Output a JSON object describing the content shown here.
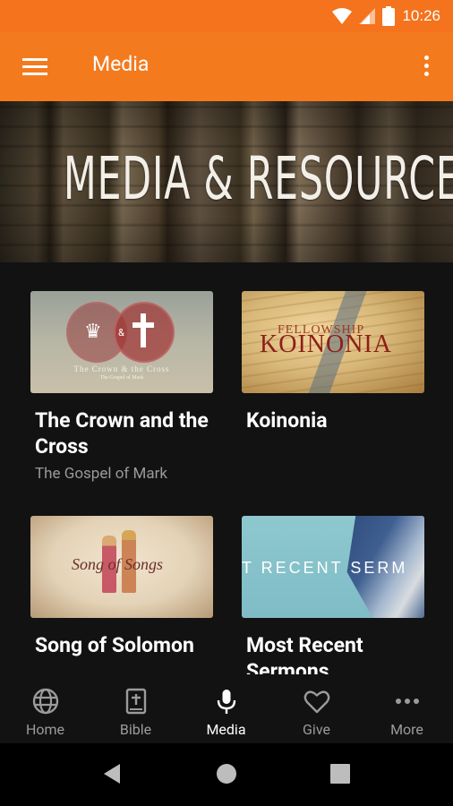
{
  "status_bar": {
    "time": "10:26"
  },
  "app_bar": {
    "title": "Media"
  },
  "hero": {
    "title": "MEDIA & RESOURCES"
  },
  "cards": [
    {
      "title": "The Crown and the Cross",
      "subtitle": "The Gospel of Mark",
      "thumb_caption": "The Crown & the Cross",
      "thumb_subcaption": "The Gospel of Mark"
    },
    {
      "title": "Koinonia",
      "subtitle": "",
      "thumb_fellow": "FELLOWSHIP",
      "thumb_main": "KOINONIA"
    },
    {
      "title": "Song of Solomon",
      "subtitle": "",
      "thumb_main": "Song of Songs"
    },
    {
      "title": "Most Recent Sermons",
      "subtitle": "",
      "thumb_main": "T RECENT SERM"
    }
  ],
  "bottom_nav": [
    {
      "label": "Home",
      "icon": "globe-icon"
    },
    {
      "label": "Bible",
      "icon": "bible-icon"
    },
    {
      "label": "Media",
      "icon": "microphone-icon",
      "active": true
    },
    {
      "label": "Give",
      "icon": "heart-icon"
    },
    {
      "label": "More",
      "icon": "more-dots-icon"
    }
  ],
  "colors": {
    "accent": "#f47a1e",
    "background": "#121212",
    "nav_inactive": "#9b9b9b"
  }
}
